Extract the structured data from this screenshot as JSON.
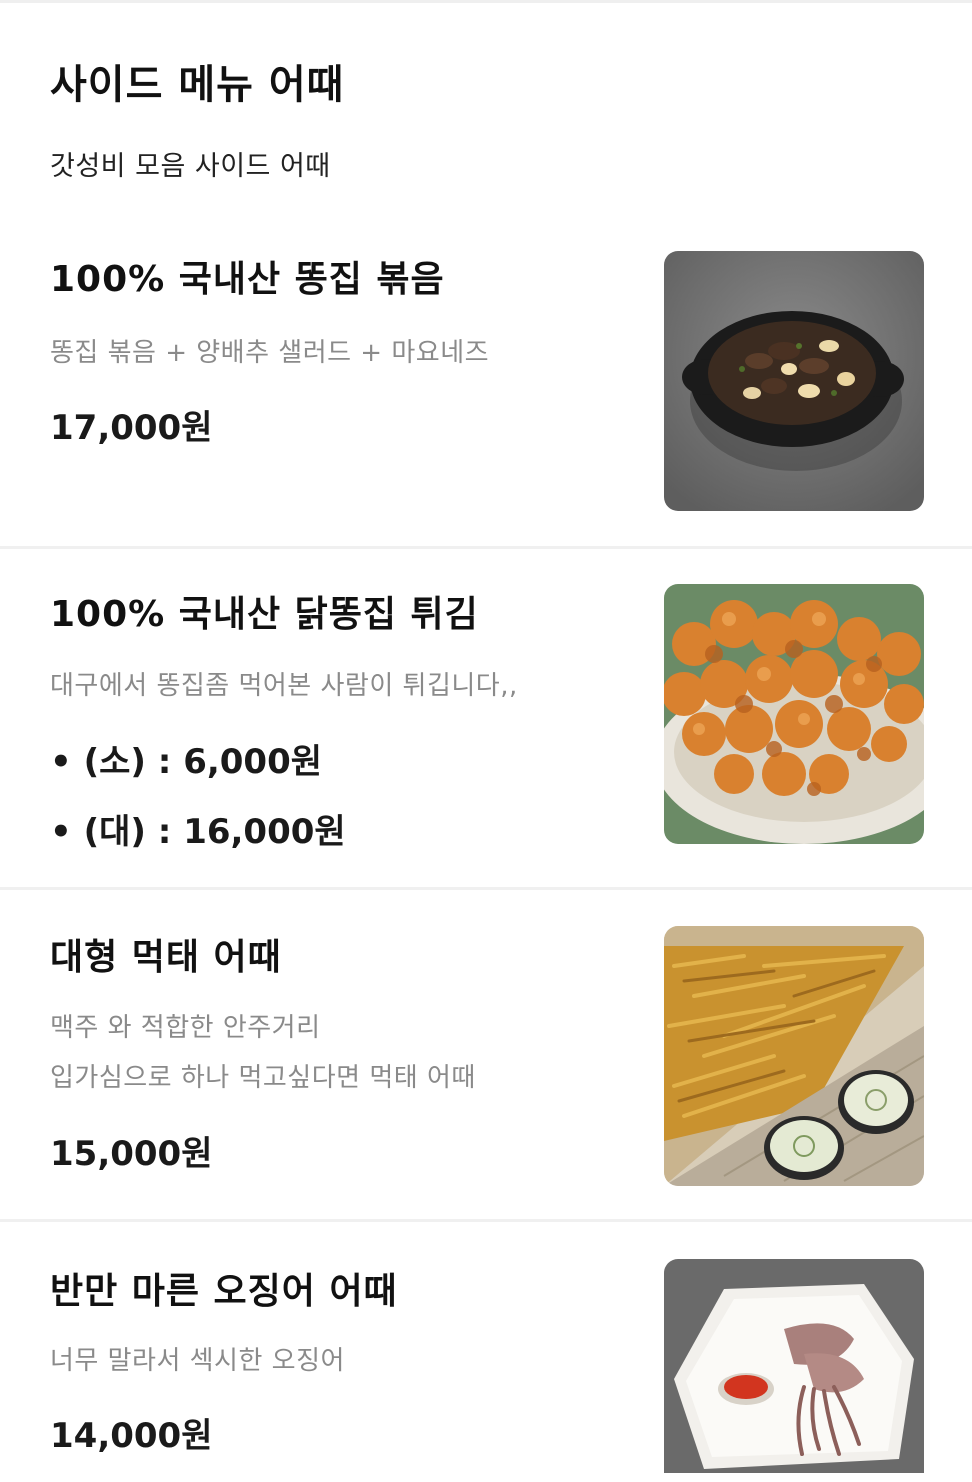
{
  "section": {
    "title": "사이드 메뉴 어때",
    "subtitle": "갓성비 모음 사이드 어때"
  },
  "items": [
    {
      "name": "100% 국내산 똥집 볶음",
      "desc": "똥집 볶음 + 양배추 샐러드 + 마요네즈",
      "price": "17,000원",
      "image_icon": "stir-fried-gizzard-photo"
    },
    {
      "name": "100% 국내산 닭똥집 튀김",
      "desc": "대구에서 똥집좀 먹어본 사람이 튀깁니다,,",
      "price_lines": [
        "• (소) : 6,000원",
        "• (대) : 16,000원"
      ],
      "image_icon": "fried-gizzard-photo"
    },
    {
      "name": "대형 먹태 어때",
      "desc_lines": [
        "맥주 와 적합한 안주거리",
        "입가심으로 하나 먹고싶다면 먹태 어때"
      ],
      "price": "15,000원",
      "image_icon": "dried-pollock-photo"
    },
    {
      "name": "반만 마른 오징어 어때",
      "desc": "너무 말라서 섹시한 오징어",
      "price": "14,000원",
      "image_icon": "half-dried-squid-photo"
    }
  ]
}
